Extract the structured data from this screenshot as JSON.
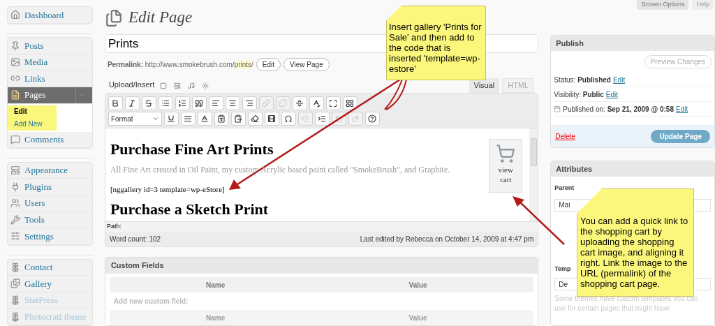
{
  "top_bar": {
    "screen_options": "Screen Options",
    "help": "Help"
  },
  "sidebar": {
    "groups": [
      [
        {
          "label": "Dashboard",
          "selected": false
        }
      ],
      [
        {
          "label": "Posts",
          "selected": false
        },
        {
          "label": "Media",
          "selected": false
        },
        {
          "label": "Links",
          "selected": false
        },
        {
          "label": "Pages",
          "selected": true,
          "expanded": true,
          "children": [
            {
              "label": "Edit",
              "selected": true
            },
            {
              "label": "Add New",
              "selected": false
            }
          ]
        },
        {
          "label": "Comments",
          "selected": false
        }
      ],
      [
        {
          "label": "Appearance",
          "selected": false
        },
        {
          "label": "Plugins",
          "selected": false
        },
        {
          "label": "Users",
          "selected": false
        },
        {
          "label": "Tools",
          "selected": false
        },
        {
          "label": "Settings",
          "selected": false
        }
      ],
      [
        {
          "label": "Contact",
          "selected": false
        },
        {
          "label": "Gallery",
          "selected": false
        },
        {
          "label": "StatPress",
          "selected": false
        },
        {
          "label": "Photocrati theme",
          "selected": false
        }
      ]
    ]
  },
  "page_title": "Edit Page",
  "title_field": {
    "value": "Prints"
  },
  "permalink": {
    "label": "Permalink:",
    "url": "http://www.smokebrush.com/",
    "slug": "prints",
    "suffix": "/",
    "buttons": [
      "Edit",
      "View Page"
    ]
  },
  "upload_insert": "Upload/Insert",
  "editor_tabs": [
    {
      "label": "Visual",
      "selected": true
    },
    {
      "label": "HTML",
      "selected": false
    }
  ],
  "toolbar": {
    "row_1": [
      {
        "disabled": false
      },
      {
        "disabled": false
      },
      {
        "disabled": false
      },
      {
        "disabled": false
      },
      {
        "disabled": false
      },
      {
        "disabled": false
      },
      {
        "disabled": false
      },
      {
        "disabled": false
      },
      {
        "disabled": false
      },
      {
        "disabled": true
      },
      {
        "disabled": true
      },
      {
        "disabled": false
      },
      {
        "disabled": false
      },
      {
        "disabled": false
      },
      {
        "disabled": false
      }
    ],
    "format": "Format",
    "row_2": [
      {
        "disabled": false
      },
      {
        "disabled": false
      },
      {
        "disabled": false
      },
      {
        "disabled": false
      },
      {
        "disabled": false
      },
      {
        "disabled": false
      },
      {
        "disabled": false
      },
      {
        "disabled": false
      },
      {
        "disabled": true
      },
      {
        "disabled": false
      },
      {
        "disabled": true
      },
      {
        "disabled": true
      },
      {
        "disabled": false
      }
    ]
  },
  "content": {
    "heading_1": "Purchase Fine Art Prints",
    "paragraph": "All Fine Art created in Oil Paint, my custom Acrylic based paint called \"SmokeBrush\", and Graphite.",
    "shortcode": "[nggallery id=3 template=wp-eStore]",
    "heading_2": "Purchase a Sketch Print",
    "cart_caption": "view cart"
  },
  "path": "Path:",
  "word_count": "Word count: 102",
  "last_edited": "Last edited by Rebecca on October 14, 2009 at 4:47 pm",
  "custom_fields": {
    "title": "Custom Fields",
    "columns": [
      "Name",
      "Value"
    ],
    "add_label": "Add new custom field:",
    "new_columns": [
      "Name",
      "Value"
    ]
  },
  "publish": {
    "title": "Publish",
    "preview": "Preview Changes",
    "rows": [
      {
        "label": "Status:",
        "value": "Published",
        "link": "Edit"
      },
      {
        "label": "Visibility:",
        "value": "Public",
        "link": "Edit"
      },
      {
        "label": "Published on:",
        "value": "Sep 21, 2009 @ 0:58",
        "link": "Edit"
      }
    ],
    "delete": "Delete",
    "update": "Update Page"
  },
  "attributes": {
    "title": "Attributes",
    "parent_label": "Parent",
    "parent_value": "Mai",
    "template_label": "Temp",
    "template_value": "De",
    "note": "Some themes have custom templates you can use for certain pages that might have"
  },
  "callouts": [
    "Insert gallery 'Prints for Sale' and then add to the code that is inserted 'template=wp-estore'",
    "You can add a quick link to the shopping cart by uploading the shopping cart image, and aligning it right. Link the image to the URL (permalink) of the shopping cart page."
  ]
}
